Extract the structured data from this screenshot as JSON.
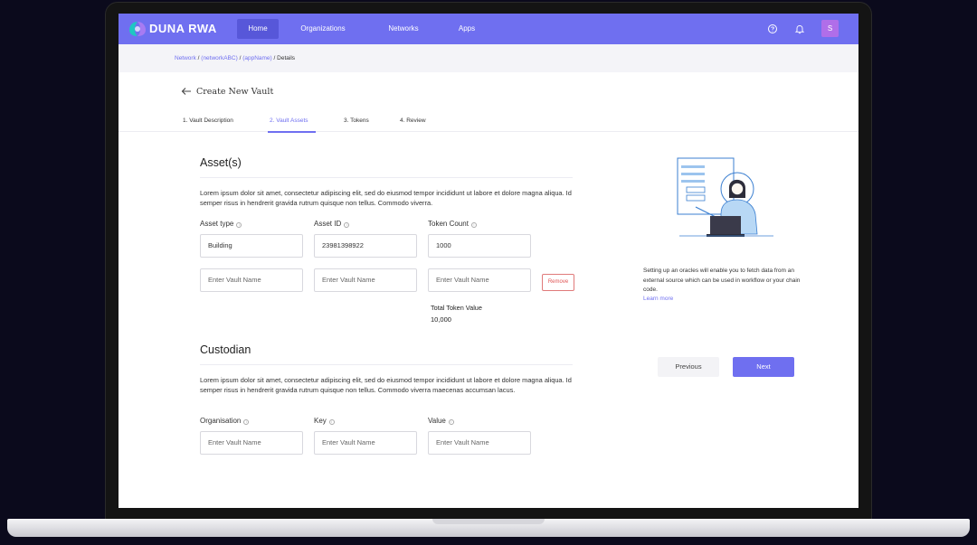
{
  "brand": {
    "name": "DUNA RWA",
    "logo_icon": "duna-logo-icon"
  },
  "nav": {
    "items": [
      {
        "label": "Home",
        "active": true
      },
      {
        "label": "Organizations",
        "active": false
      },
      {
        "label": "Networks",
        "active": false
      },
      {
        "label": "Apps",
        "active": false
      }
    ],
    "help_icon": "help-circle-icon",
    "bell_icon": "bell-icon",
    "avatar_initial": "S"
  },
  "breadcrumb": {
    "items": [
      "Network",
      "(networkABC)",
      "(appName)",
      "Details"
    ],
    "separator": "/"
  },
  "page": {
    "title": "Create New Vault",
    "back_icon": "arrow-left-icon"
  },
  "steps": [
    {
      "label": "1. Vault Description",
      "active": false
    },
    {
      "label": "2. Vault Assets",
      "active": true
    },
    {
      "label": "3. Tokens",
      "active": false
    },
    {
      "label": "4. Review",
      "active": false
    }
  ],
  "assets": {
    "title": "Asset(s)",
    "description": "Lorem ipsum dolor sit amet, consectetur adipiscing elit, sed do eiusmod tempor incididunt ut labore et dolore magna aliqua. Id semper risus in hendrerit gravida rutrum quisque non tellus. Commodo viverra.",
    "labels": {
      "asset_type": "Asset type",
      "asset_id": "Asset ID",
      "token_count": "Token Count"
    },
    "row1": {
      "asset_type": "Building",
      "asset_id": "23981398922",
      "token_count": "1000"
    },
    "row2_placeholder": "Enter Vault Name",
    "remove_label": "Remove",
    "total_label": "Total Token Value",
    "total_value": "10,000"
  },
  "custodian": {
    "title": "Custodian",
    "description": "Lorem ipsum dolor sit amet, consectetur adipiscing elit, sed do eiusmod tempor incididunt ut labore et dolore magna aliqua. Id semper risus in hendrerit gravida rutrum quisque non tellus. Commodo viverra maecenas accumsan lacus.",
    "labels": {
      "organisation": "Organisation",
      "key": "Key",
      "value": "Value"
    },
    "placeholder": "Enter Vault Name"
  },
  "sidebar": {
    "illustration_icon": "person-with-laptop-illustration",
    "helper_text": "Setting up an oracles will enable you to fetch data from an external source which can be used in workflow or your chain code.",
    "learn_more": "Learn more"
  },
  "actions": {
    "previous": "Previous",
    "next": "Next"
  },
  "colors": {
    "primary": "#6f6ff0",
    "nav_active": "#5757d9",
    "avatar": "#b06ee9",
    "danger": "#e05555"
  }
}
